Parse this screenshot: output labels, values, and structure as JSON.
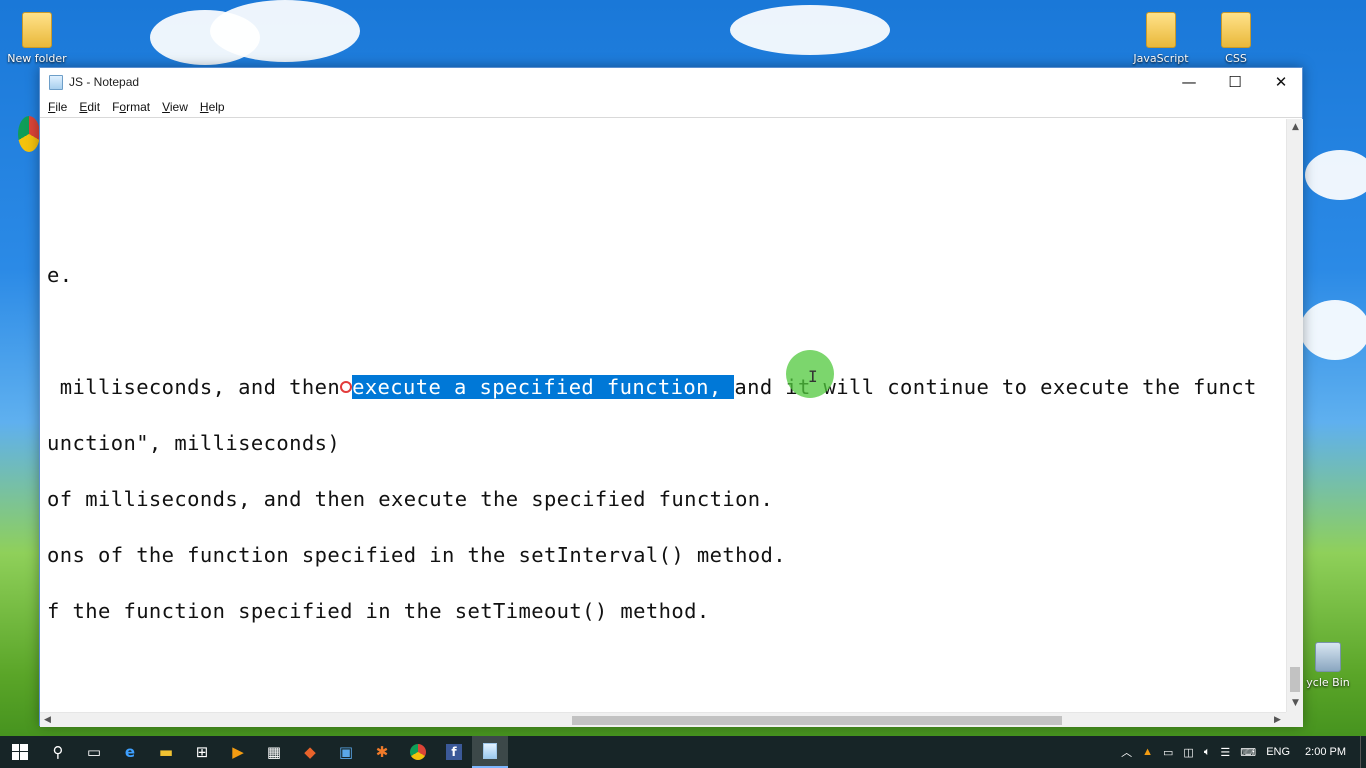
{
  "desktop": {
    "icons": [
      {
        "label": "New folder",
        "icon": "folder-icon"
      },
      {
        "label": "JavaScript",
        "icon": "folder-icon"
      },
      {
        "label": "CSS",
        "icon": "folder-icon"
      },
      {
        "label": "ycle Bin",
        "icon": "recycle-bin-icon"
      }
    ]
  },
  "window": {
    "title": "JS - Notepad",
    "controls": {
      "minimize": "—",
      "maximize": "☐",
      "close": "✕"
    }
  },
  "menu": {
    "items": [
      {
        "accel": "F",
        "rest": "ile"
      },
      {
        "accel": "E",
        "rest": "dit"
      },
      {
        "accel": "o",
        "pre": "F",
        "rest": "rmat"
      },
      {
        "accel": "V",
        "rest": "iew"
      },
      {
        "accel": "H",
        "rest": "elp"
      }
    ]
  },
  "editor": {
    "lines": [
      {
        "text": "e."
      },
      {
        "before": " milliseconds, and then",
        "selected": "execute a specified function, ",
        "after": "and it will continue to execute the funct"
      },
      {
        "text": "unction\", milliseconds)"
      },
      {
        "text": "of milliseconds, and then execute the specified function."
      },
      {
        "text": "ons of the function specified in the setInterval() method."
      },
      {
        "text": "f the function specified in the setTimeout() method."
      }
    ]
  },
  "taskbar": {
    "apps": [
      "windows-start-icon",
      "search-icon",
      "task-view-icon",
      "edge-icon",
      "file-explorer-icon",
      "store-icon",
      "media-player-icon",
      "film-icon",
      "game-icon",
      "outlook-icon",
      "paint-icon",
      "chrome-icon",
      "facebook-icon",
      "notepad-icon"
    ],
    "tray": {
      "language": "ENG",
      "time": "2:00 PM"
    }
  },
  "colors": {
    "selection": "#0078d7",
    "taskbar": "#141c28",
    "window_border": "#5a8fd0"
  }
}
